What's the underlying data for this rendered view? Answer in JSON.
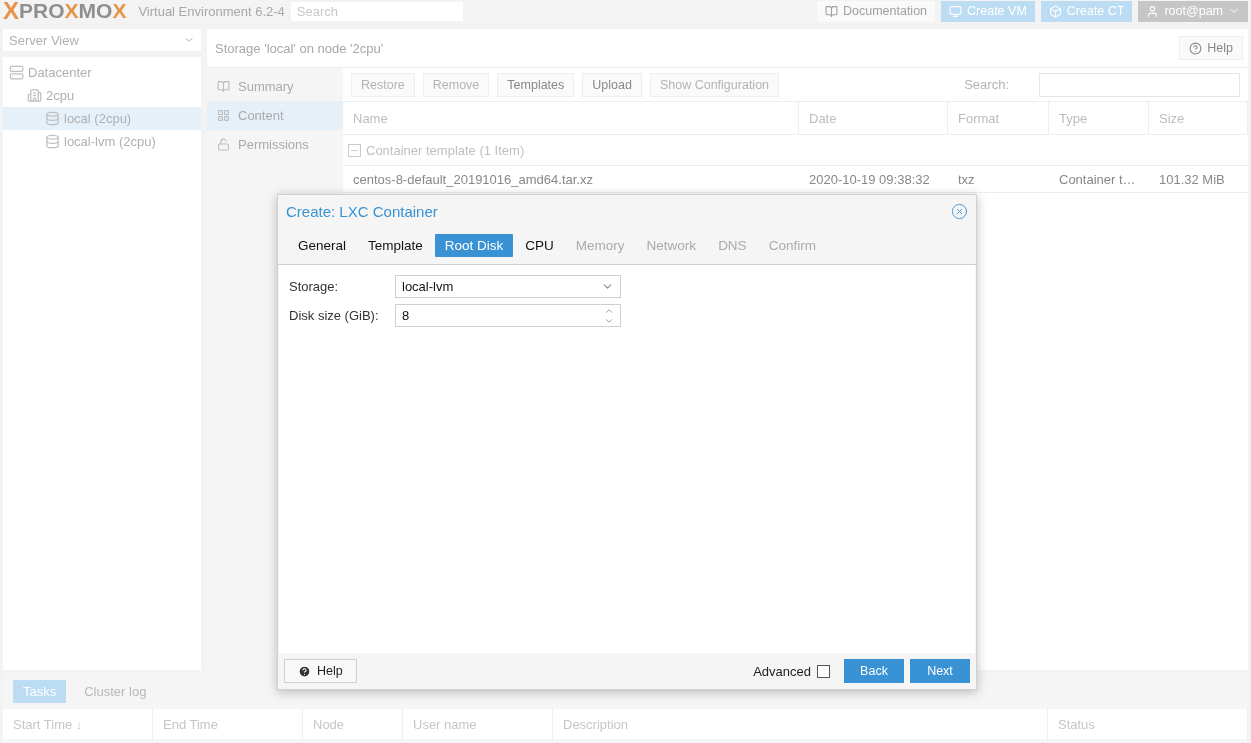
{
  "header": {
    "logo": [
      {
        "text": "X",
        "accent": true
      },
      {
        "text": "PRO",
        "accent": false
      },
      {
        "text": "X",
        "accent": true
      },
      {
        "text": "MO",
        "accent": false
      },
      {
        "text": "X",
        "accent": true
      }
    ],
    "version": "Virtual Environment 6.2-4",
    "search": {
      "placeholder": "Search"
    },
    "buttons": [
      {
        "label": "Documentation",
        "kind": "doc"
      },
      {
        "label": "Create VM",
        "kind": "vm"
      },
      {
        "label": "Create CT",
        "kind": "ct"
      },
      {
        "label": "root@pam",
        "kind": "user"
      }
    ]
  },
  "sidebar": {
    "view": "Server View",
    "tree": [
      {
        "label": "Datacenter",
        "kind": "datacenter",
        "selected": false,
        "children": [
          {
            "label": "2cpu",
            "kind": "node",
            "selected": false,
            "children": [
              {
                "label": "local (2cpu)",
                "kind": "storage",
                "selected": true
              },
              {
                "label": "local-lvm (2cpu)",
                "kind": "storage",
                "selected": false
              }
            ]
          }
        ]
      }
    ]
  },
  "main": {
    "title": "Storage 'local' on node '2cpu'",
    "help": "Help",
    "nav": [
      {
        "label": "Summary",
        "kind": "summary",
        "selected": false
      },
      {
        "label": "Content",
        "kind": "content",
        "selected": true
      },
      {
        "label": "Permissions",
        "kind": "permissions",
        "selected": false
      }
    ],
    "toolbar": [
      {
        "label": "Restore",
        "disabled": true
      },
      {
        "label": "Remove",
        "disabled": true
      },
      {
        "label": "Templates",
        "disabled": false
      },
      {
        "label": "Upload",
        "disabled": false
      },
      {
        "label": "Show Configuration",
        "disabled": true
      }
    ],
    "search_label": "Search:",
    "columns": [
      "Name",
      "Date",
      "Format",
      "Type",
      "Size"
    ],
    "group": "Container template (1 Item)",
    "rows": [
      [
        "centos-8-default_20191016_amd64.tar.xz",
        "2020-10-19 09:38:32",
        "txz",
        "Container t…",
        "101.32 MiB"
      ]
    ]
  },
  "dialog": {
    "title": "Create: LXC Container",
    "tabs": [
      {
        "label": "General",
        "selected": false,
        "disabled": false
      },
      {
        "label": "Template",
        "selected": false,
        "disabled": false
      },
      {
        "label": "Root Disk",
        "selected": true,
        "disabled": false
      },
      {
        "label": "CPU",
        "selected": false,
        "disabled": false
      },
      {
        "label": "Memory",
        "selected": false,
        "disabled": true
      },
      {
        "label": "Network",
        "selected": false,
        "disabled": true
      },
      {
        "label": "DNS",
        "selected": false,
        "disabled": true
      },
      {
        "label": "Confirm",
        "selected": false,
        "disabled": true
      }
    ],
    "fields": [
      {
        "label": "Storage:",
        "value": "local-lvm",
        "kind": "select"
      },
      {
        "label": "Disk size (GiB):",
        "value": "8",
        "kind": "spinner"
      }
    ],
    "help": "Help",
    "advanced": {
      "label": "Advanced",
      "checked": false
    },
    "buttons": [
      "Back",
      "Next"
    ]
  },
  "bottom": {
    "tabs": [
      {
        "label": "Tasks",
        "selected": true
      },
      {
        "label": "Cluster log",
        "selected": false
      }
    ],
    "columns": [
      "Start Time ↓",
      "End Time",
      "Node",
      "User name",
      "Description",
      "Status"
    ]
  }
}
